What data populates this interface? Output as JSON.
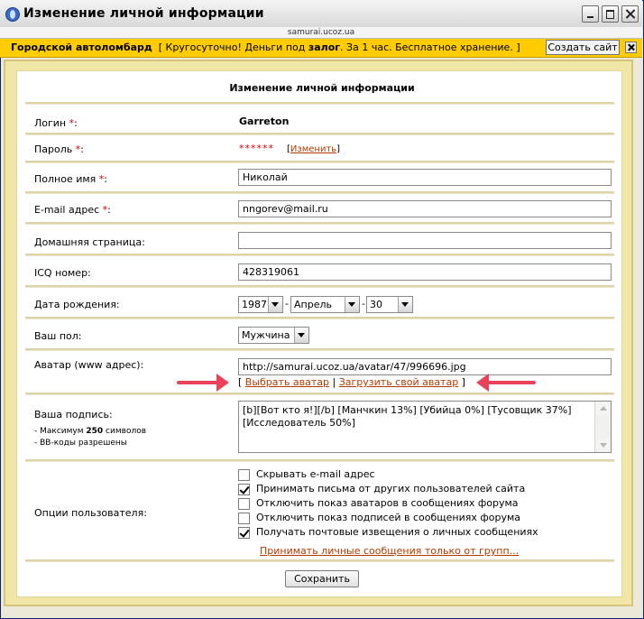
{
  "window": {
    "title": "Изменение личной информации",
    "url": "samurai.ucoz.ua"
  },
  "ad": {
    "brand": "Городской автоломбард",
    "text_before": "[ Кругосуточно! Деньги под ",
    "text_bold": "залог",
    "text_after": ". За 1 час. Бесплатное хранение. ]",
    "button": "Создать сайт"
  },
  "form": {
    "title": "Изменение личной информации",
    "required_mark": "*",
    "login": {
      "label": "Логин ",
      "suffix": ":",
      "value": "Garreton"
    },
    "password": {
      "label": "Пароль ",
      "suffix": ":",
      "stars": "******",
      "link_open": "[",
      "link": "Изменить",
      "link_close": "]"
    },
    "fullname": {
      "label": "Полное имя ",
      "suffix": ":",
      "value": "Николай"
    },
    "email": {
      "label": "E-mail адрес ",
      "suffix": ":",
      "value": "nngorev@mail.ru"
    },
    "homepage": {
      "label": "Домашняя страница:",
      "value": ""
    },
    "icq": {
      "label": "ICQ номер:",
      "value": "428319061"
    },
    "birthdate": {
      "label": "Дата рождения:",
      "year": "1987",
      "month": "Апрель",
      "day": "30",
      "dash": "-"
    },
    "gender": {
      "label": "Ваш пол:",
      "value": "Мужчина"
    },
    "avatar": {
      "label": "Аватар (www адрес):",
      "value": "http://samurai.ucoz.ua/avatar/47/996696.jpg",
      "open": "[ ",
      "choose": "Выбрать аватар",
      "sep": " | ",
      "upload": "Загрузить свой аватар",
      "close": " ]"
    },
    "signature": {
      "label": "Ваша подпись:",
      "max_prefix": "- Максимум ",
      "max_num": "250",
      "max_suffix": " символов",
      "bbcode": "- BB-коды разрешены",
      "value": "[b][Вот кто я!][/b] [Манчкин 13%] [Убийца 0%] [Тусовщик 37%] [Исследователь 50%]"
    },
    "options": {
      "label": "Опции пользователя:",
      "items": [
        {
          "label": "Скрывать e-mail адрес",
          "checked": false
        },
        {
          "label": "Принимать письма от других пользователей сайта",
          "checked": true
        },
        {
          "label": "Отключить показ аватаров в сообщениях форума",
          "checked": false
        },
        {
          "label": "Отключить показ подписей в сообщениях форума",
          "checked": false
        },
        {
          "label": "Получать почтовые извещения о личных сообщениях",
          "checked": true
        }
      ],
      "groups_link": "Принимать личные сообщения только от групп..."
    },
    "save": "Сохранить"
  }
}
